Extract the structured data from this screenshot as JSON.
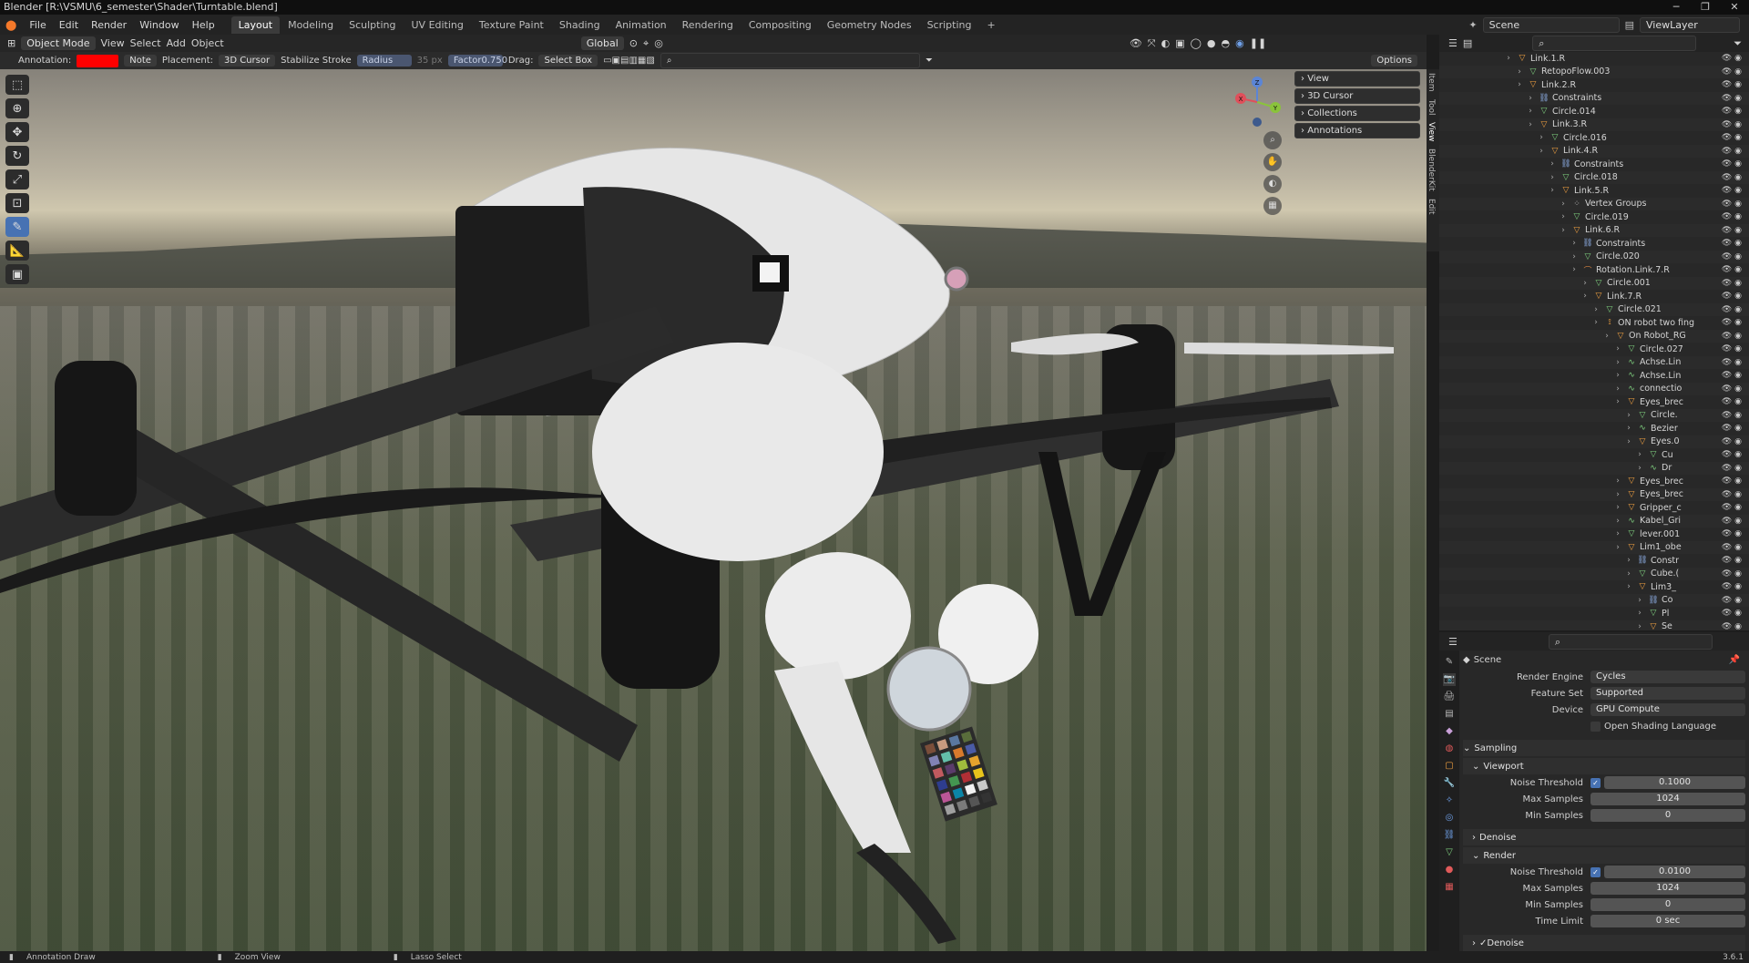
{
  "window": {
    "title": "Blender [R:\\VSMU\\6_semester\\Shader\\Turntable.blend]"
  },
  "menu": {
    "items": [
      "File",
      "Edit",
      "Render",
      "Window",
      "Help"
    ]
  },
  "workspaces": {
    "tabs": [
      "Layout",
      "Modeling",
      "Sculpting",
      "UV Editing",
      "Texture Paint",
      "Shading",
      "Animation",
      "Rendering",
      "Compositing",
      "Geometry Nodes",
      "Scripting"
    ],
    "active": "Layout"
  },
  "topright": {
    "scene": "Scene",
    "view_layer": "ViewLayer"
  },
  "header": {
    "mode": "Object Mode",
    "view": "View",
    "select": "Select",
    "add": "Add",
    "object": "Object",
    "transform": "Global",
    "options": "Options"
  },
  "tool_settings": {
    "annotation_label": "Annotation:",
    "annotation_color": "#ff0000",
    "note": "Note",
    "placement_label": "Placement:",
    "placement": "3D Cursor",
    "stabilize": "Stabilize Stroke",
    "radius_label": "Radius",
    "radius_value": "35 px",
    "factor_label": "Factor",
    "factor_value": "0.750",
    "drag_label": "Drag:",
    "drag": "Select Box"
  },
  "npanel": {
    "sections": [
      "View",
      "3D Cursor",
      "Collections",
      "Annotations"
    ],
    "tabs": [
      "Item",
      "Tool",
      "View",
      "BlenderKit",
      "Edit"
    ]
  },
  "gizmo": {
    "z": "Z",
    "y": "Y",
    "x": "X"
  },
  "outliner": {
    "rows": [
      {
        "depth": 0,
        "name": "Link.1.R",
        "icon": "object-icon"
      },
      {
        "depth": 1,
        "name": "RetopoFlow.003",
        "icon": "mesh-icon"
      },
      {
        "depth": 1,
        "name": "Link.2.R",
        "icon": "object-icon"
      },
      {
        "depth": 2,
        "name": "Constraints",
        "icon": "constraint-icon"
      },
      {
        "depth": 2,
        "name": "Circle.014",
        "icon": "mesh-icon"
      },
      {
        "depth": 2,
        "name": "Link.3.R",
        "icon": "object-icon"
      },
      {
        "depth": 3,
        "name": "Circle.016",
        "icon": "mesh-icon"
      },
      {
        "depth": 3,
        "name": "Link.4.R",
        "icon": "object-icon"
      },
      {
        "depth": 4,
        "name": "Constraints",
        "icon": "constraint-icon"
      },
      {
        "depth": 4,
        "name": "Circle.018",
        "icon": "mesh-icon"
      },
      {
        "depth": 4,
        "name": "Link.5.R",
        "icon": "object-icon"
      },
      {
        "depth": 5,
        "name": "Vertex Groups",
        "icon": "vertex-group-icon"
      },
      {
        "depth": 5,
        "name": "Circle.019",
        "icon": "mesh-icon"
      },
      {
        "depth": 5,
        "name": "Link.6.R",
        "icon": "object-icon"
      },
      {
        "depth": 6,
        "name": "Constraints",
        "icon": "constraint-icon"
      },
      {
        "depth": 6,
        "name": "Circle.020",
        "icon": "mesh-icon"
      },
      {
        "depth": 6,
        "name": "Rotation.Link.7.R",
        "icon": "empty-icon"
      },
      {
        "depth": 7,
        "name": "Circle.001",
        "icon": "mesh-icon"
      },
      {
        "depth": 7,
        "name": "Link.7.R",
        "icon": "object-icon"
      },
      {
        "depth": 8,
        "name": "Circle.021",
        "icon": "mesh-icon"
      },
      {
        "depth": 8,
        "name": "ON robot two fing",
        "icon": "armature-icon"
      },
      {
        "depth": 9,
        "name": "On Robot_RG",
        "icon": "object-icon"
      },
      {
        "depth": 10,
        "name": "Circle.027",
        "icon": "mesh-icon"
      },
      {
        "depth": 10,
        "name": "Achse.Lin",
        "icon": "curve-icon"
      },
      {
        "depth": 10,
        "name": "Achse.Lin",
        "icon": "curve-icon"
      },
      {
        "depth": 10,
        "name": "connectio",
        "icon": "curve-icon"
      },
      {
        "depth": 10,
        "name": "Eyes_brec",
        "icon": "object-icon"
      },
      {
        "depth": 11,
        "name": "Circle.",
        "icon": "mesh-icon"
      },
      {
        "depth": 11,
        "name": "Bezier",
        "icon": "curve-icon"
      },
      {
        "depth": 11,
        "name": "Eyes.0",
        "icon": "object-icon"
      },
      {
        "depth": 12,
        "name": "Cu",
        "icon": "mesh-icon"
      },
      {
        "depth": 12,
        "name": "Dr",
        "icon": "curve-icon"
      },
      {
        "depth": 10,
        "name": "Eyes_brec",
        "icon": "object-icon"
      },
      {
        "depth": 10,
        "name": "Eyes_brec",
        "icon": "object-icon"
      },
      {
        "depth": 10,
        "name": "Gripper_c",
        "icon": "object-icon"
      },
      {
        "depth": 10,
        "name": "Kabel_Gri",
        "icon": "curve-icon"
      },
      {
        "depth": 10,
        "name": "lever.001",
        "icon": "mesh-icon"
      },
      {
        "depth": 10,
        "name": "Lim1_obe",
        "icon": "object-icon"
      },
      {
        "depth": 11,
        "name": "Constr",
        "icon": "constraint-icon"
      },
      {
        "depth": 11,
        "name": "Cube.(",
        "icon": "mesh-icon"
      },
      {
        "depth": 11,
        "name": "Lim3_",
        "icon": "object-icon"
      },
      {
        "depth": 12,
        "name": "Co",
        "icon": "constraint-icon"
      },
      {
        "depth": 12,
        "name": "Pl",
        "icon": "mesh-icon"
      },
      {
        "depth": 12,
        "name": "Se",
        "icon": "object-icon"
      }
    ]
  },
  "properties": {
    "context": "Scene",
    "render_engine_label": "Render Engine",
    "render_engine": "Cycles",
    "feature_set_label": "Feature Set",
    "feature_set": "Supported",
    "device_label": "Device",
    "device": "GPU Compute",
    "osl": "Open Shading Language",
    "sampling": "Sampling",
    "viewport": "Viewport",
    "noise_threshold_label": "Noise Threshold",
    "vp_noise": "0.1000",
    "max_samples_label": "Max Samples",
    "vp_max": "1024",
    "min_samples_label": "Min Samples",
    "vp_min": "0",
    "denoise": "Denoise",
    "render": "Render",
    "r_noise": "0.0100",
    "r_max": "1024",
    "r_min": "0",
    "time_limit_label": "Time Limit",
    "r_time": "0 sec",
    "denoise2": "Denoise"
  },
  "status": {
    "left": "Annotation Draw",
    "middle": "Zoom View",
    "right": "Lasso Select",
    "version": "3.6.1"
  }
}
